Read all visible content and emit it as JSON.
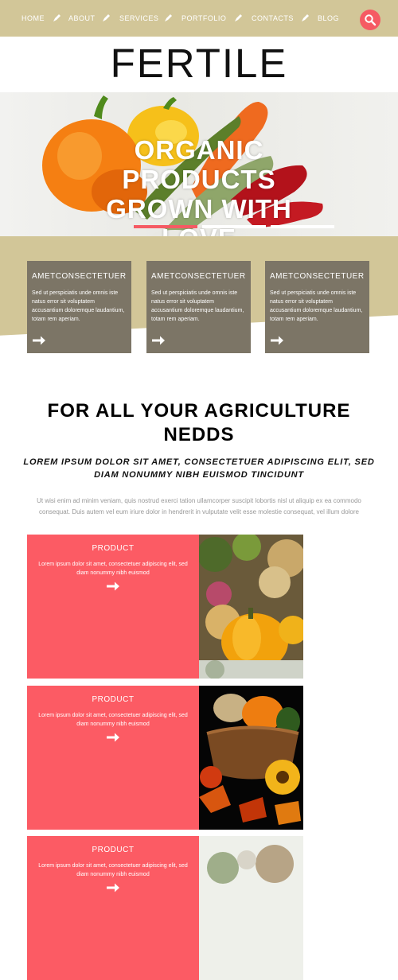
{
  "nav": {
    "items": [
      "HOME",
      "ABOUT",
      "SERVICES",
      "PORTFOLIO",
      "CONTACTS",
      "BLOG"
    ],
    "search_icon": "search-icon",
    "accent": "#f55a63",
    "bar_color": "#d2c698"
  },
  "logo": "FERTILE",
  "hero": {
    "line1": "ORGANIC",
    "line2": "PRODUCTS",
    "line3": "GROWN WITH",
    "line4": "LOVE"
  },
  "features": [
    {
      "title": "AMETCONSECTETUER",
      "text": "Sed ut perspiciatis unde omnis iste natus error sit voluptatem accusantium doloremque laudantium, totam rem aperiam."
    },
    {
      "title": "AMETCONSECTETUER",
      "text": "Sed ut perspiciatis unde omnis iste natus error sit voluptatem accusantium doloremque laudantium, totam rem aperiam."
    },
    {
      "title": "AMETCONSECTETUER",
      "text": "Sed ut perspiciatis unde omnis iste natus error sit voluptatem accusantium doloremque laudantium, totam rem aperiam."
    }
  ],
  "section": {
    "title_line1": "FOR ALL YOUR AGRICULTURE",
    "title_line2": "NEDDS",
    "subtitle": "LOREM IPSUM DOLOR SIT AMET, CONSECTETUER ADIPISCING ELIT, SED DIAM NONUMMY NIBH EUISMOD TINCIDUNT",
    "body": "Ut wisi enim ad minim veniam, quis nostrud exerci tation ullamcorper suscipit lobortis nisl ut aliquip ex ea commodo consequat. Duis autem vel eum iriure dolor in hendrerit in vulputate velit esse molestie consequat, vel illum dolore"
  },
  "products": [
    {
      "title": "PRODUCT",
      "text": "Lorem ipsum dolor sit amet, consectetuer adipiscing elit, sed diam nonummy nibh euismod"
    },
    {
      "title": "PRODUCT",
      "text": "Lorem ipsum dolor sit amet, consectetuer adipiscing elit, sed diam nonummy nibh euismod"
    },
    {
      "title": "PRODUCT",
      "text": "Lorem ipsum dolor sit amet, consectetuer adipiscing elit, sed diam nonummy nibh euismod"
    }
  ],
  "colors": {
    "feature_box": "#7c7566",
    "product_card": "#fc5b64"
  }
}
